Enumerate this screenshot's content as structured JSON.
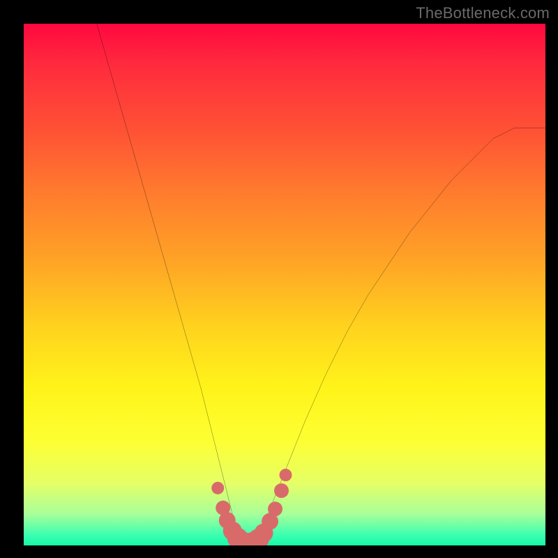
{
  "watermark": "TheBottleneck.com",
  "chart_data": {
    "type": "line",
    "title": "",
    "xlabel": "",
    "ylabel": "",
    "xlim": [
      0,
      100
    ],
    "ylim": [
      0,
      100
    ],
    "grid": false,
    "series": [
      {
        "name": "bottleneck-curve",
        "x": [
          14,
          16,
          18,
          20,
          22,
          24,
          26,
          28,
          30,
          32,
          34,
          36,
          37.5,
          39,
          40,
          41,
          42,
          43,
          44,
          46,
          48,
          50,
          54,
          58,
          62,
          66,
          70,
          74,
          78,
          82,
          86,
          90,
          94,
          98,
          100
        ],
        "y": [
          100,
          93,
          86,
          79,
          72,
          65,
          58,
          51,
          44,
          37,
          30,
          22,
          16,
          10,
          6,
          3,
          1,
          0.4,
          1,
          4,
          9,
          14,
          24,
          33,
          41,
          48,
          54,
          60,
          65,
          70,
          74,
          78,
          80,
          80,
          80
        ]
      }
    ],
    "markers": {
      "name": "highlight-dots",
      "color": "#d96a6a",
      "points": [
        {
          "x": 37.2,
          "y": 11.0,
          "r": 1.2
        },
        {
          "x": 38.2,
          "y": 7.2,
          "r": 1.4
        },
        {
          "x": 39.0,
          "y": 4.8,
          "r": 1.6
        },
        {
          "x": 40.0,
          "y": 2.8,
          "r": 1.8
        },
        {
          "x": 41.0,
          "y": 1.4,
          "r": 2.0
        },
        {
          "x": 42.0,
          "y": 0.6,
          "r": 2.0
        },
        {
          "x": 43.0,
          "y": 0.4,
          "r": 2.0
        },
        {
          "x": 44.0,
          "y": 0.6,
          "r": 2.0
        },
        {
          "x": 45.0,
          "y": 1.2,
          "r": 2.0
        },
        {
          "x": 46.0,
          "y": 2.4,
          "r": 1.8
        },
        {
          "x": 47.2,
          "y": 4.6,
          "r": 1.6
        },
        {
          "x": 48.2,
          "y": 7.0,
          "r": 1.4
        },
        {
          "x": 49.4,
          "y": 10.5,
          "r": 1.4
        },
        {
          "x": 50.2,
          "y": 13.5,
          "r": 1.2
        }
      ]
    },
    "gradient_stops": [
      {
        "pos": 0,
        "color": "#ff083f"
      },
      {
        "pos": 8,
        "color": "#ff2b3d"
      },
      {
        "pos": 20,
        "color": "#ff5035"
      },
      {
        "pos": 32,
        "color": "#ff7a2e"
      },
      {
        "pos": 45,
        "color": "#ffa226"
      },
      {
        "pos": 58,
        "color": "#ffd21e"
      },
      {
        "pos": 70,
        "color": "#fff41a"
      },
      {
        "pos": 80,
        "color": "#fdff33"
      },
      {
        "pos": 88,
        "color": "#e6ff66"
      },
      {
        "pos": 94,
        "color": "#a8ff9a"
      },
      {
        "pos": 98,
        "color": "#3bffb0"
      },
      {
        "pos": 100,
        "color": "#18f7a8"
      }
    ]
  }
}
